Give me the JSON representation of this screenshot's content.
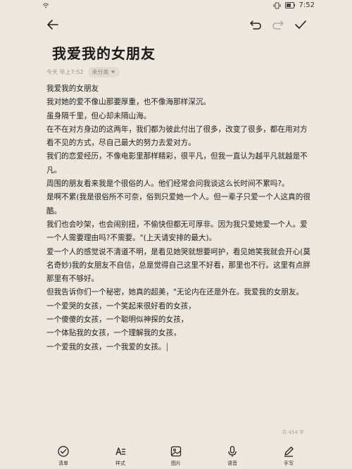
{
  "status": {
    "time": "7:52"
  },
  "note": {
    "title": "我爱我的女朋友",
    "meta_time": "今天 早上7:52",
    "category": "未分类",
    "lines": [
      "我爱我的女朋友",
      "我对她的爱不像山那要厚重，也不像海那样深沉。",
      "虽身隔千里，但心却未隔山海。",
      "在不在对方身边的这两年，我们都为彼此付出了很多，改变了很多，都在用对方看不见的方式，尽自己最大的努力去爱对方。",
      "我们的恋爱经历，不像电影里那样精彩，很平凡，但我一直认为越平凡就越是不凡。",
      "周围的朋友看来我是个很俗的人。他们经常会问我谈这么长时间不累吗?。",
      "是啊不累(我是很俗所不可奈，俗到只爱她一个人。但一辈子只爱一个人这真的很酷。",
      "我们也会吵架，也会闹别扭，不偷快但都无可厚非。因为我只爱她爱一个人。爱一个人需要理由吗?不需要。\"(上天请安排的最大)。",
      "爱一个人的感觉说不清道不明，是看见她哭就想要呵护，看见她笑我就会开心(莫名奇妙)我的女朋友不自信，总是觉得自己这里不好看，那里也不行。这里有点胖那里有不够好。",
      "但我告诉你们一个秘密，她真的超美，\"无论内在还是外在。我爱我的女朋友。",
      "一个爱哭的女孩，一个笑起来很好看的女孩，",
      "一个傻傻的女孩，一个聪明似神探的女孩，",
      "一个体贴我的女孩，一个理解我的女孩，",
      "一个爱我的女孩，一个我爱的女孩。"
    ],
    "word_count": "共 454 字"
  },
  "bottom_bar": {
    "items": [
      {
        "label": "清单",
        "icon": "checklist-icon"
      },
      {
        "label": "样式",
        "icon": "text-style-icon"
      },
      {
        "label": "图片",
        "icon": "image-icon"
      },
      {
        "label": "语音",
        "icon": "microphone-icon"
      },
      {
        "label": "手写",
        "icon": "pen-icon"
      }
    ]
  }
}
